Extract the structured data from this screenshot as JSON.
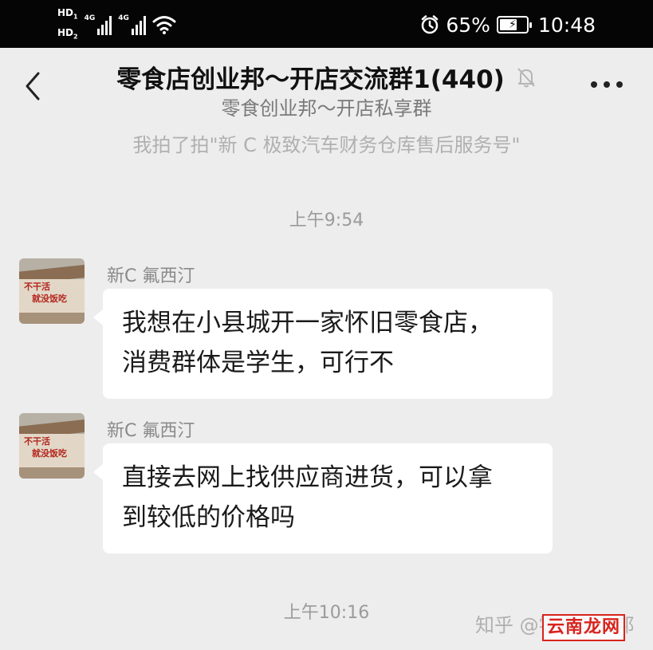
{
  "status_bar": {
    "hd1": "HD",
    "hd1_sub": "1",
    "hd2": "HD",
    "hd2_sub": "2",
    "sig1_tag": "4G",
    "sig2_tag": "4G",
    "battery_percent": "65%",
    "battery_level": 0.65,
    "time": "10:48",
    "icons": [
      "alarm-icon",
      "wifi-icon",
      "battery-icon"
    ]
  },
  "header": {
    "title": "零食店创业邦～开店交流群1(440)",
    "subtitle": "零食创业邦～开店私享群",
    "pat_notice": "我拍了拍\"新 C 极致汽车财务仓库售后服务号\""
  },
  "messages": [
    {
      "timestamp": "上午9:54",
      "sender": "新C 氟西汀",
      "avatar_text": [
        "不干活",
        "就没饭吃"
      ],
      "lines": [
        "我想在小县城开一家怀旧零食店，",
        "消费群体是学生，可行不"
      ]
    },
    {
      "sender": "新C 氟西汀",
      "avatar_text": [
        "不干活",
        "就没饭吃"
      ],
      "lines": [
        "直接去网上找供应商进货，可以拿",
        "到较低的价格吗"
      ]
    }
  ],
  "timestamp_2": "上午10:16",
  "watermark": {
    "text": "知乎 @零食创业邦",
    "stamp": "云南龙网"
  },
  "colors": {
    "background": "#ededed",
    "status_bar": "#050505",
    "bubble": "#ffffff",
    "stamp_red": "#d9231d"
  }
}
